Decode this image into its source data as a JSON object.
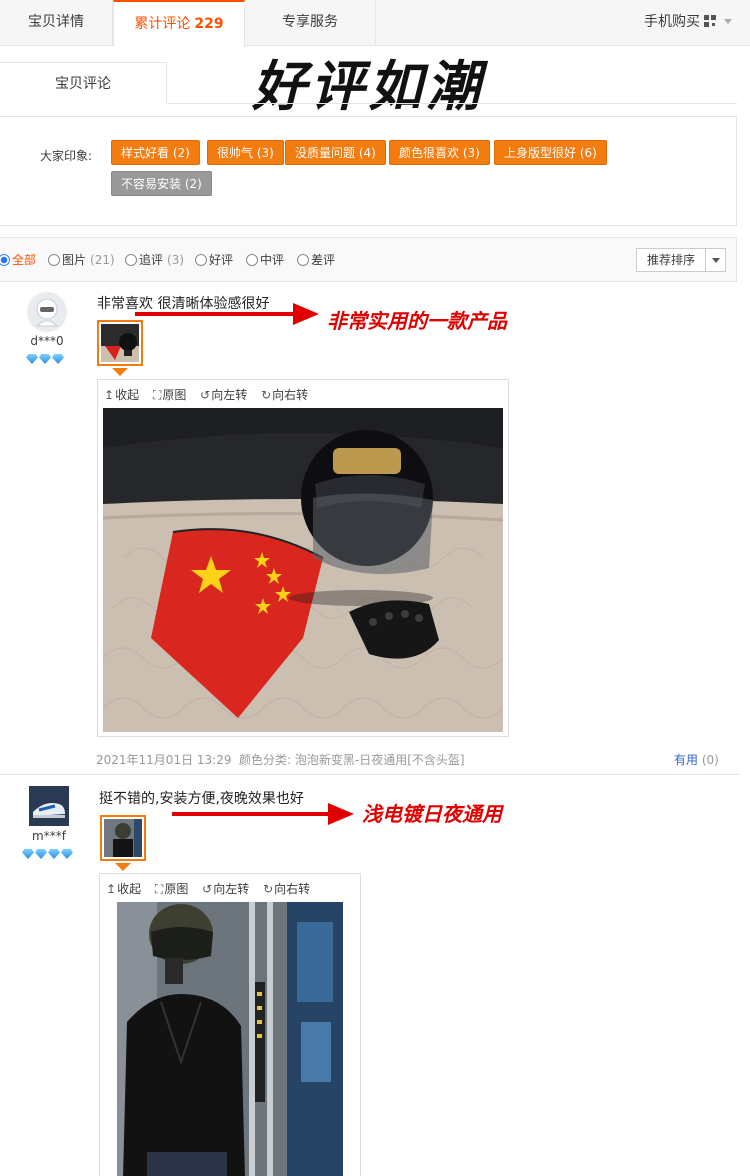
{
  "tabs": {
    "details": "宝贝详情",
    "reviews": "累计评论",
    "reviews_count": "229",
    "service": "专享服务",
    "mobile_buy": "手机购买"
  },
  "overlay_title": "好评如潮",
  "sub_tab": "宝贝评论",
  "impressions": {
    "label": "大家印象:",
    "tags": [
      {
        "text": "样式好看 (2)",
        "style": "orange"
      },
      {
        "text": "很帅气 (3)",
        "style": "orange"
      },
      {
        "text": "没质量问题 (4)",
        "style": "orange"
      },
      {
        "text": "颜色很喜欢 (3)",
        "style": "orange"
      },
      {
        "text": "上身版型很好 (6)",
        "style": "orange"
      },
      {
        "text": "不容易安装 (2)",
        "style": "gray"
      }
    ]
  },
  "filters": {
    "all": "全部",
    "pics": "图片",
    "pics_count": "(21)",
    "followup": "追评",
    "followup_count": "(3)",
    "good": "好评",
    "medium": "中评",
    "bad": "差评",
    "sort_label": "推荐排序",
    "selected": "all"
  },
  "viewer_toolbar": {
    "collapse": "收起",
    "original": "原图",
    "rotate_left": "向左转",
    "rotate_right": "向右转"
  },
  "reviews": [
    {
      "user": "d***0",
      "level_gems": 3,
      "text": "非常喜欢 很清晰体验感很好",
      "annotation": "非常实用的一款产品",
      "date": "2021年11月01日 13:29",
      "sku": "颜色分类: 泡泡新变黑-日夜通用[不含头盔]",
      "useful_label": "有用",
      "useful_count": "(0)"
    },
    {
      "user": "m***f",
      "level_gems": 4,
      "text": "挺不错的,安装方便,夜晚效果也好",
      "annotation": "浅电镀日夜通用"
    }
  ]
}
